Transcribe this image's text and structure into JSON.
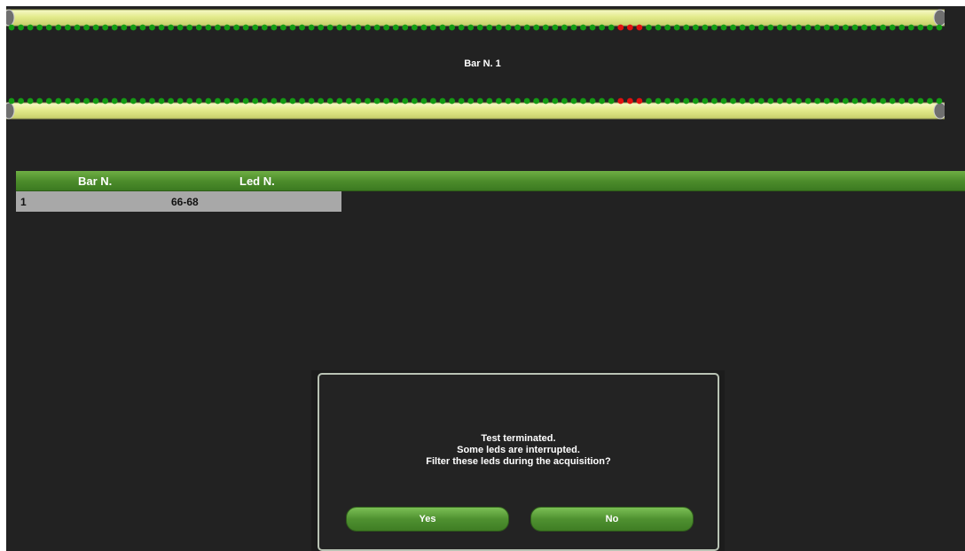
{
  "bar_title": "Bar N. 1",
  "led_strip": {
    "led_count": 100,
    "interrupted_leds": [
      66,
      67,
      68
    ],
    "ok_color": "#149a14",
    "interrupted_color": "#e01010",
    "tube_color": "#e3eb8c"
  },
  "table": {
    "headers": {
      "bar": "Bar N.",
      "led": "Led N."
    },
    "rows": [
      {
        "bar": "1",
        "led": "66-68"
      }
    ]
  },
  "dialog": {
    "line1": "Test terminated.",
    "line2": "Some leds are interrupted.",
    "line3": "Filter these leds during the acquisition?",
    "yes_label": "Yes",
    "no_label": "No"
  }
}
